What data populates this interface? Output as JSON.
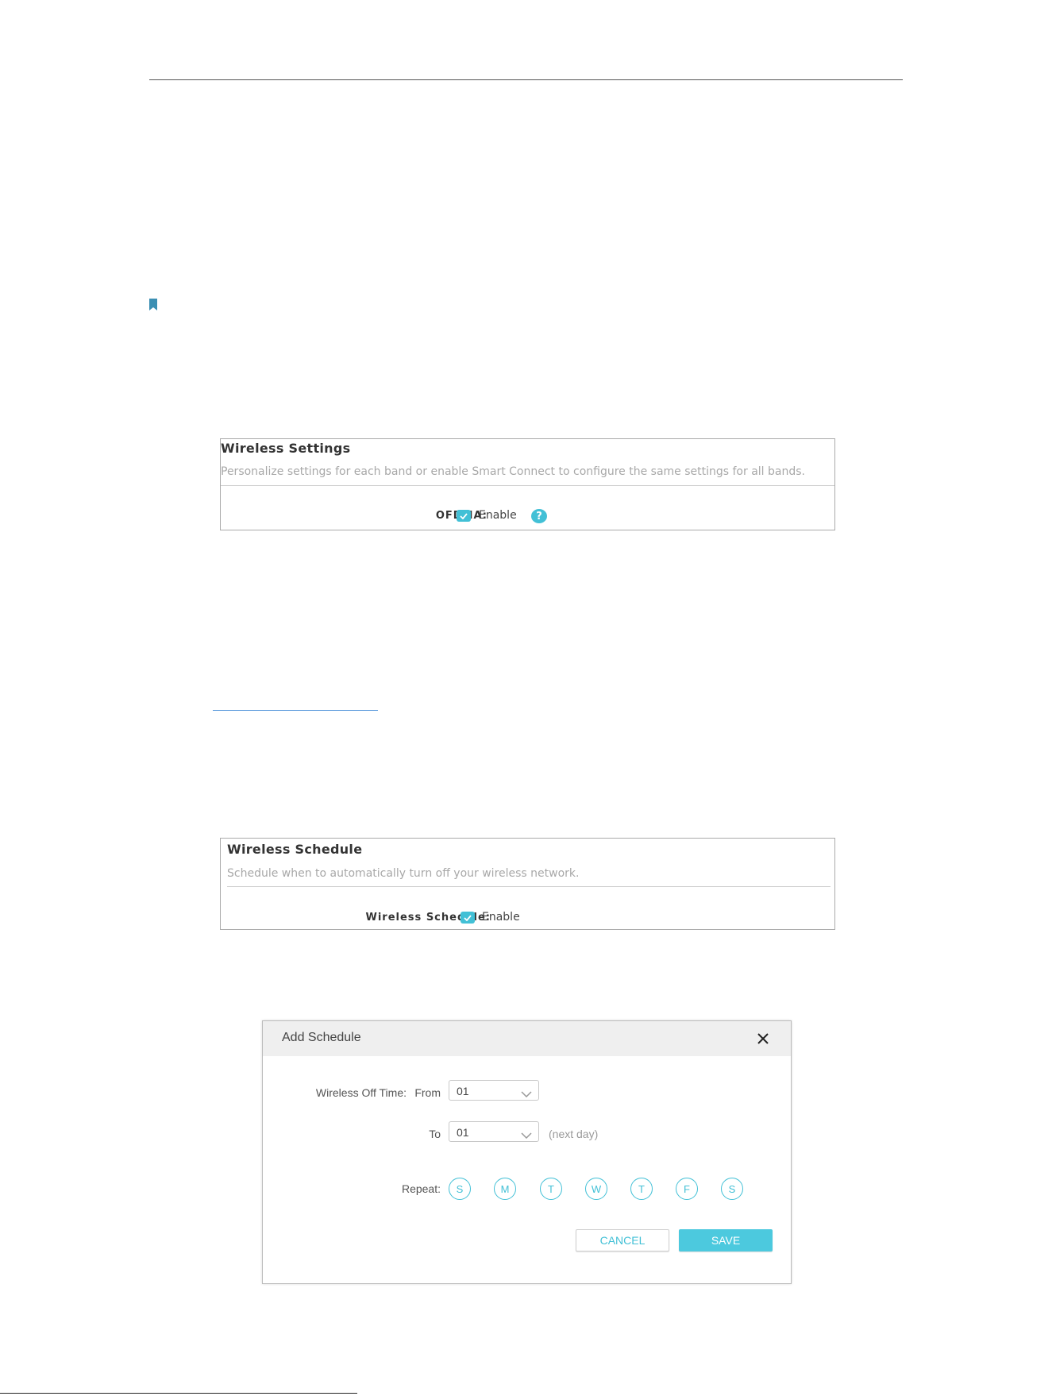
{
  "wireless_settings": {
    "title": "Wireless Settings",
    "description": "Personalize settings for each band or enable Smart Connect to configure the same settings for all bands.",
    "ofdma_label": "OFDMA:",
    "enable_label": "Enable",
    "enabled": true,
    "help_icon": "question-mark-icon"
  },
  "wireless_schedule": {
    "title": "Wireless Schedule",
    "description": "Schedule when to automatically turn off your wireless network.",
    "field_label": "Wireless Schedule:",
    "enable_label": "Enable",
    "enabled": true
  },
  "add_schedule_dialog": {
    "title": "Add Schedule",
    "off_time_label": "Wireless Off Time:",
    "from_label": "From",
    "from_value": "01",
    "to_label": "To",
    "to_value": "01",
    "next_day_hint": "(next day)",
    "repeat_label": "Repeat:",
    "days": [
      "S",
      "M",
      "T",
      "W",
      "T",
      "F",
      "S"
    ],
    "cancel_label": "CANCEL",
    "save_label": "SAVE"
  },
  "colors": {
    "accent": "#42c0d6",
    "note_icon": "#3b8fb3",
    "link": "#4a90d9"
  }
}
